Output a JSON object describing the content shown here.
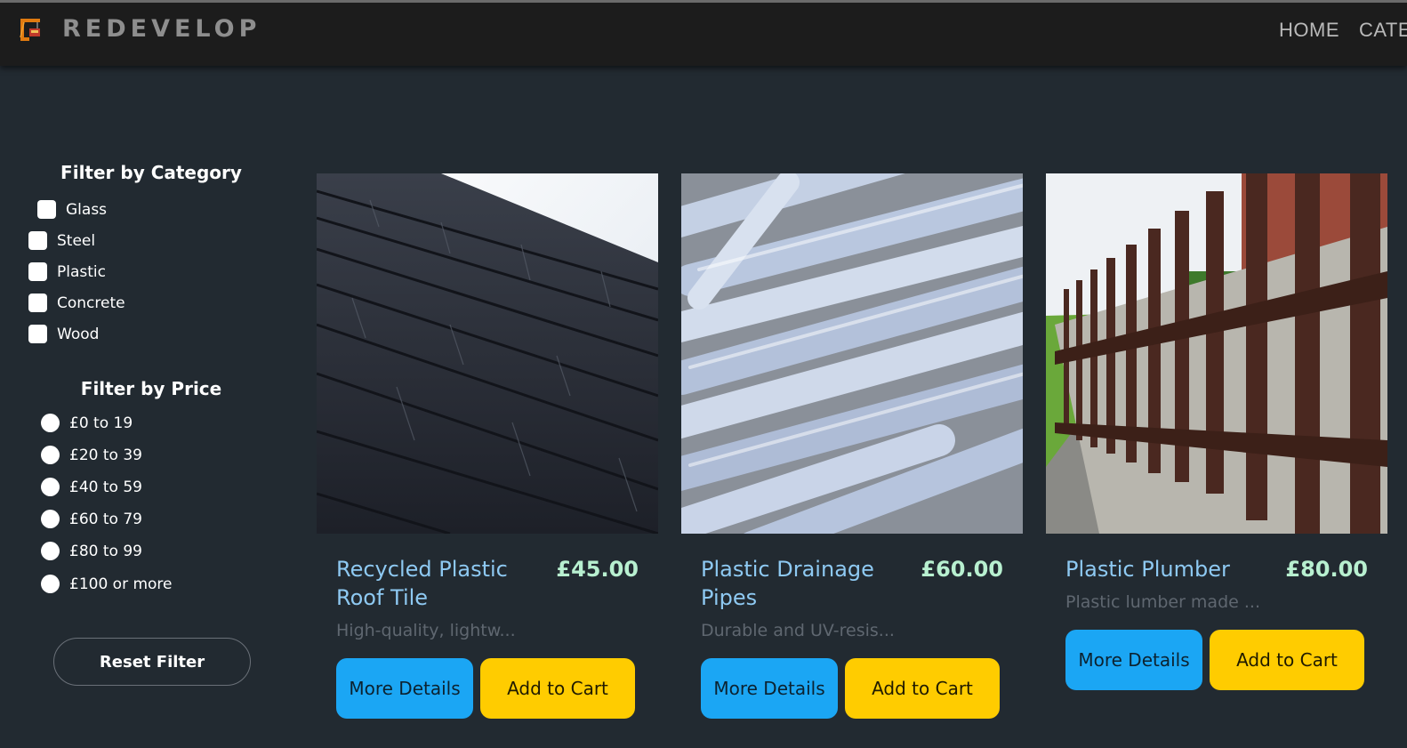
{
  "header": {
    "brand": "REDEVELOP",
    "logo_icon": "crane-icon",
    "nav": [
      "HOME",
      "CATE"
    ]
  },
  "sidebar": {
    "category_title": "Filter by Category",
    "categories": [
      "Glass",
      "Steel",
      "Plastic",
      "Concrete",
      "Wood"
    ],
    "price_title": "Filter by Price",
    "prices": [
      "£0 to 19",
      "£20 to 39",
      "£40 to 59",
      "£60 to 79",
      "£80 to 99",
      "£100 or more"
    ],
    "reset_label": "Reset Filter"
  },
  "products": [
    {
      "title": "Recycled Plastic Roof Tile",
      "price": "£45.00",
      "description": "High-quality, lightw...",
      "more_label": "More Details",
      "cart_label": "Add to Cart"
    },
    {
      "title": "Plastic Drainage Pipes",
      "price": "£60.00",
      "description": "Durable and UV-resis...",
      "more_label": "More Details",
      "cart_label": "Add to Cart"
    },
    {
      "title": "Plastic Plumber",
      "price": "£80.00",
      "description": "Plastic lumber made ...",
      "more_label": "More Details",
      "cart_label": "Add to Cart"
    }
  ],
  "colors": {
    "background": "#222a31",
    "navbar": "#1c1c1c",
    "title_blue": "#8ec9f2",
    "price_green": "#b8f0d0",
    "button_blue": "#1ba6f4",
    "button_yellow": "#ffcc00"
  }
}
